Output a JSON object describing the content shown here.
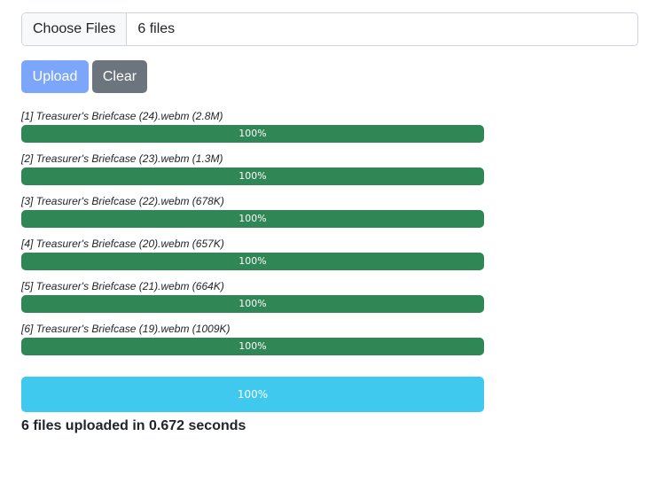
{
  "file_input": {
    "button_label": "Choose Files",
    "selected_text": "6 files"
  },
  "buttons": {
    "upload_label": "Upload",
    "clear_label": "Clear"
  },
  "files": [
    {
      "label": "[1] Treasurer's Briefcase (24).webm (2.8M)",
      "progress_text": "100%",
      "progress": 100
    },
    {
      "label": "[2] Treasurer's Briefcase (23).webm (1.3M)",
      "progress_text": "100%",
      "progress": 100
    },
    {
      "label": "[3] Treasurer's Briefcase (22).webm (678K)",
      "progress_text": "100%",
      "progress": 100
    },
    {
      "label": "[4] Treasurer's Briefcase (20).webm (657K)",
      "progress_text": "100%",
      "progress": 100
    },
    {
      "label": "[5] Treasurer's Briefcase (21).webm (664K)",
      "progress_text": "100%",
      "progress": 100
    },
    {
      "label": "[6] Treasurer's Briefcase (19).webm (1009K)",
      "progress_text": "100%",
      "progress": 100
    }
  ],
  "total": {
    "progress_text": "100%",
    "progress": 100
  },
  "summary": "6 files uploaded in 0.672 seconds",
  "colors": {
    "upload_button": "#7ca6fa",
    "clear_button": "#6c757d",
    "file_progress": "#2e8754",
    "total_progress": "#3fc9ef"
  }
}
